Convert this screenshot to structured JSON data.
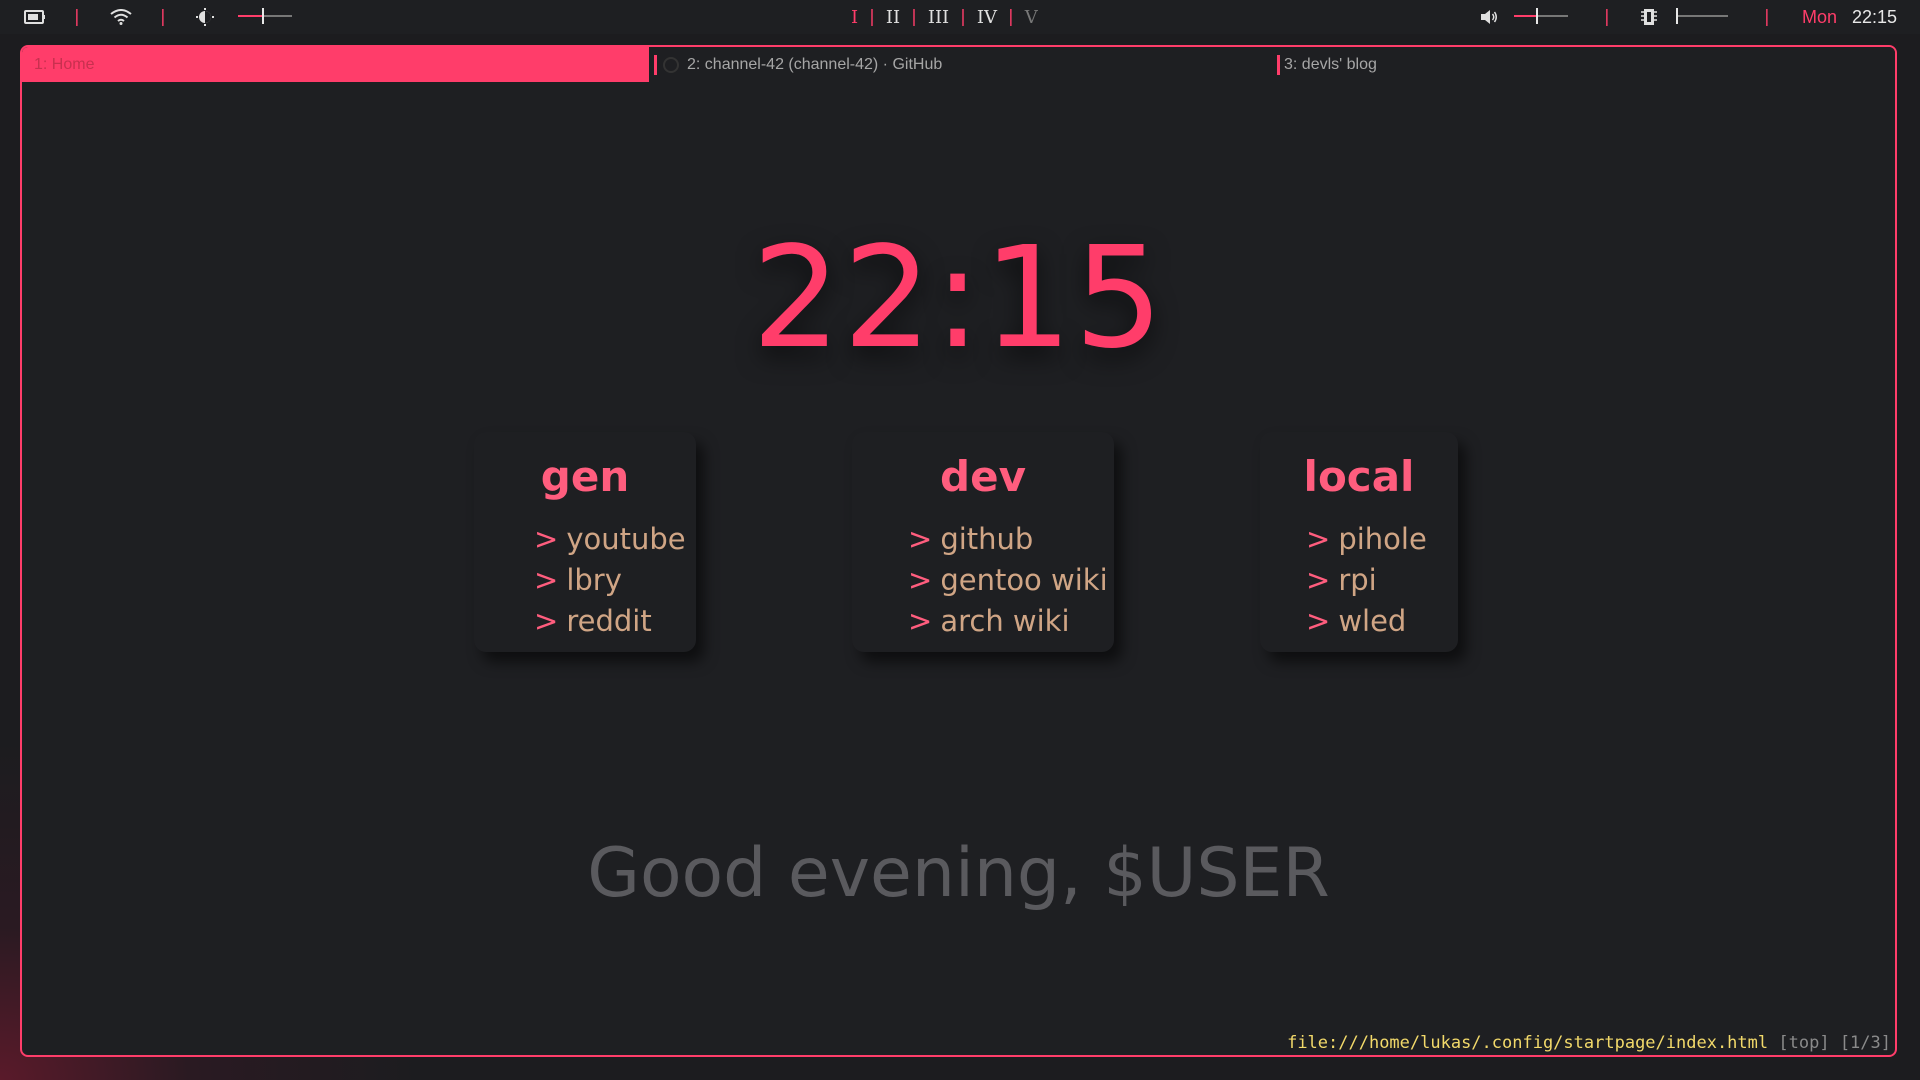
{
  "topbar": {
    "workspaces": [
      {
        "label": "I",
        "state": "active"
      },
      {
        "label": "II",
        "state": "normal"
      },
      {
        "label": "III",
        "state": "normal"
      },
      {
        "label": "IV",
        "state": "normal"
      },
      {
        "label": "V",
        "state": "dim"
      }
    ],
    "separator": "|",
    "day": "Mon",
    "time": "22:15",
    "brightness_level": 0.45,
    "volume_level": 0.4,
    "memory_level": 0.0,
    "icons": [
      "battery-icon",
      "wifi-icon",
      "brightness-icon",
      "volume-icon",
      "memory-icon"
    ],
    "accent_color": "#ff3d6a"
  },
  "browser": {
    "tabs": [
      {
        "label": "1: Home",
        "active": true
      },
      {
        "label": "2: channel-42 (channel-42) · GitHub",
        "active": false
      },
      {
        "label": "3: devls' blog",
        "active": false
      }
    ],
    "status": {
      "url": "file:///home/lukas/.config/startpage/index.html",
      "scroll": "[top]",
      "tab_index": "[1/3]"
    }
  },
  "page": {
    "clock": "22:15",
    "greeting": "Good evening, $USER",
    "link_prefix": ">",
    "cards": [
      {
        "title": "gen",
        "links": [
          "youtube",
          "lbry",
          "reddit"
        ]
      },
      {
        "title": "dev",
        "links": [
          "github",
          "gentoo wiki",
          "arch wiki"
        ]
      },
      {
        "title": "local",
        "links": [
          "pihole",
          "rpi",
          "wled"
        ]
      }
    ]
  }
}
